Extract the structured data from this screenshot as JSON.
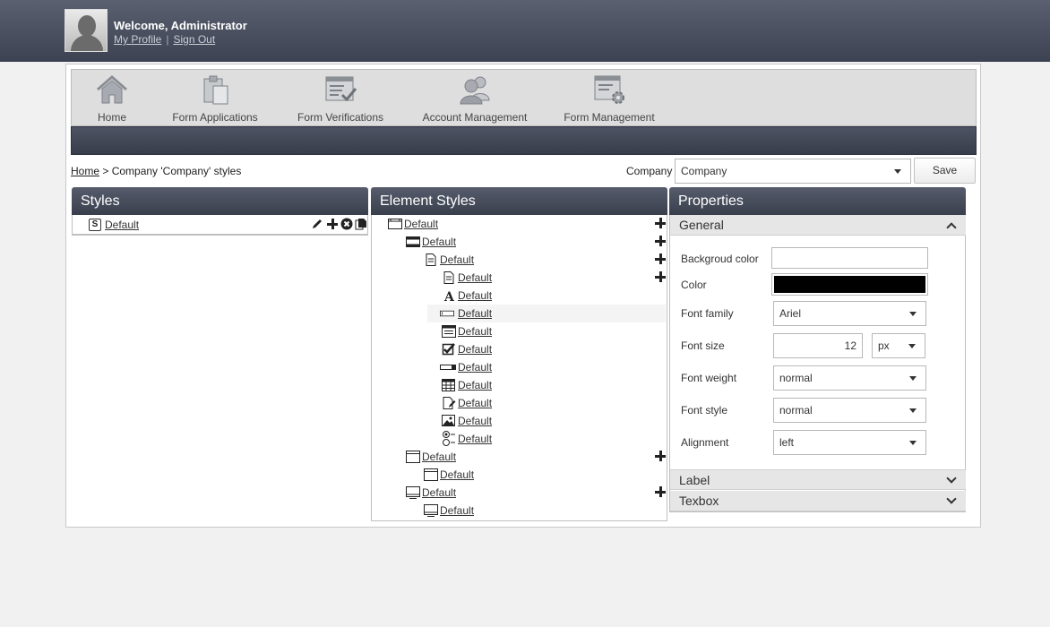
{
  "header": {
    "welcome": "Welcome, Administrator",
    "my_profile": "My Profile",
    "separator": "|",
    "sign_out": "Sign Out"
  },
  "nav": {
    "items": [
      {
        "label": "Home",
        "icon": "home-icon"
      },
      {
        "label": "Form Applications",
        "icon": "clipboard-icon"
      },
      {
        "label": "Form Verifications",
        "icon": "form-check-icon"
      },
      {
        "label": "Account Management",
        "icon": "users-icon"
      },
      {
        "label": "Form Management",
        "icon": "form-gear-icon"
      }
    ]
  },
  "breadcrumb": {
    "home": "Home",
    "rest": " > Company 'Company' styles"
  },
  "company": {
    "label": "Company",
    "selected": "Company"
  },
  "save_label": "Save",
  "styles_panel": {
    "title": "Styles",
    "items": [
      {
        "label": "Default",
        "icon": "style-s-icon"
      }
    ],
    "tools": [
      "edit-icon",
      "add-icon",
      "delete-icon",
      "copy-icon"
    ]
  },
  "element_styles": {
    "title": "Element Styles",
    "rows": [
      {
        "label": "Default",
        "icon": "window-icon"
      },
      {
        "label": "Default",
        "icon": "film-icon"
      },
      {
        "label": "Default",
        "icon": "page-icon"
      },
      {
        "label": "Default",
        "icon": "page-icon"
      },
      {
        "label": "Default",
        "icon": "text-a-icon"
      },
      {
        "label": "Default",
        "icon": "textbox-icon"
      },
      {
        "label": "Default",
        "icon": "form-icon"
      },
      {
        "label": "Default",
        "icon": "checkbox-icon"
      },
      {
        "label": "Default",
        "icon": "slider-icon"
      },
      {
        "label": "Default",
        "icon": "grid-icon"
      },
      {
        "label": "Default",
        "icon": "document-edit-icon"
      },
      {
        "label": "Default",
        "icon": "image-icon"
      },
      {
        "label": "Default",
        "icon": "radio-icon"
      },
      {
        "label": "Default",
        "icon": "panel-icon"
      },
      {
        "label": "Default",
        "icon": "panel-icon"
      },
      {
        "label": "Default",
        "icon": "monitor-icon"
      },
      {
        "label": "Default",
        "icon": "monitor-icon"
      }
    ]
  },
  "properties": {
    "title": "Properties",
    "general": {
      "title": "General",
      "background_color_label": "Backgroud color",
      "background_color": "#ffffff",
      "color_label": "Color",
      "color": "#000000",
      "font_family_label": "Font family",
      "font_family": "Ariel",
      "font_size_label": "Font size",
      "font_size": "12",
      "font_size_unit": "px",
      "font_weight_label": "Font weight",
      "font_weight": "normal",
      "font_style_label": "Font style",
      "font_style": "normal",
      "alignment_label": "Alignment",
      "alignment": "left"
    },
    "label_section": "Label",
    "textbox_section": "Texbox"
  }
}
